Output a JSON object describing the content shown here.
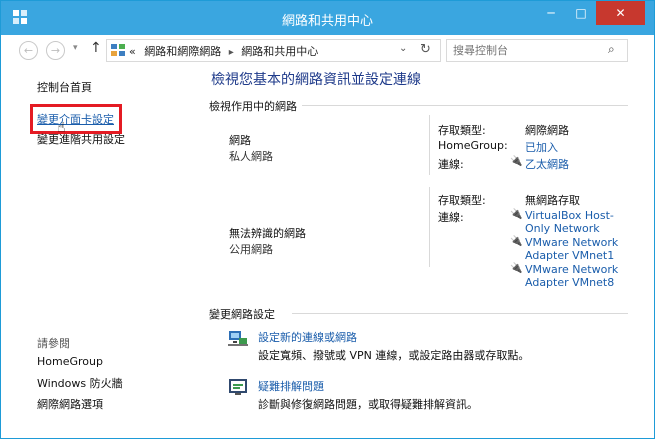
{
  "window": {
    "title": "網路和共用中心",
    "controls": {
      "minimize": "─",
      "maximize": "□",
      "close": "✕"
    }
  },
  "navbar": {
    "breadcrumb": [
      "«",
      "網路和網際網路",
      "網路和共用中心"
    ],
    "search_placeholder": "搜尋控制台"
  },
  "left_pane": {
    "home": "控制台首頁",
    "change_adapter": "變更介面卡設定",
    "change_sharing": "變更進階共用設定",
    "see_also_label": "請參閱",
    "see_also": [
      "HomeGroup",
      "Windows 防火牆",
      "網際網路選項"
    ]
  },
  "main": {
    "title": "檢視您基本的網路資訊並設定連線",
    "active_networks_header": "檢視作用中的網路",
    "networks": [
      {
        "name": "網路",
        "type": "私人網路",
        "access_type_label": "存取類型:",
        "access_type": "網際網路",
        "homegroup_label": "HomeGroup:",
        "homegroup": "已加入",
        "connections_label": "連線:",
        "connections": [
          "乙太網路"
        ]
      },
      {
        "name": "無法辨識的網路",
        "type": "公用網路",
        "access_type_label": "存取類型:",
        "access_type": "無網路存取",
        "connections_label": "連線:",
        "connections": [
          "VirtualBox Host-Only Network",
          "VMware Network Adapter VMnet1",
          "VMware Network Adapter VMnet8"
        ]
      }
    ],
    "change_settings_header": "變更網路設定",
    "tasks": [
      {
        "icon": "network-setup-icon",
        "link": "設定新的連線或網路",
        "desc": "設定寬頻、撥號或 VPN 連線，或設定路由器或存取點。"
      },
      {
        "icon": "troubleshoot-icon",
        "link": "疑難排解問題",
        "desc": "診斷與修復網路問題，或取得疑難排解資訊。"
      }
    ]
  },
  "colors": {
    "titlebar": "#3aa6e0",
    "close_button": "#c7382e",
    "link": "#1a5dab",
    "title_text": "#1e3a8a",
    "highlight_box": "#e41b23"
  }
}
